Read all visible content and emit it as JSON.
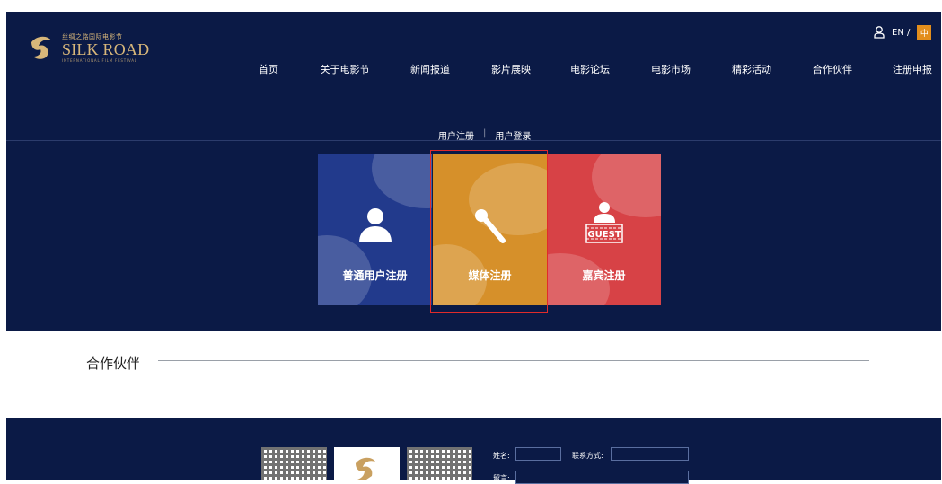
{
  "header": {
    "logo": {
      "cn": "丝绸之路国际电影节",
      "en": "SILK ROAD",
      "sub": "INTERNATIONAL FILM FESTIVAL"
    },
    "nav": [
      "首页",
      "关于电影节",
      "新闻报道",
      "影片展映",
      "电影论坛",
      "电影市场",
      "精彩活动",
      "合作伙伴",
      "注册申报"
    ],
    "lang_en": "EN /",
    "lang_zh": "中",
    "tabs": {
      "register": "用户注册",
      "separator": "|",
      "login": "用户登录"
    }
  },
  "cards": {
    "user": "普通用户注册",
    "media": "媒体注册",
    "guest": "嘉宾注册",
    "guest_icon_text": "GUEST"
  },
  "partners": {
    "title": "合作伙伴"
  },
  "footer": {
    "name_label": "姓名:",
    "contact_label": "联系方式:",
    "message_label": "留言:"
  },
  "colors": {
    "navy": "#0b1a46",
    "card_user": "#223a8c",
    "card_media": "#d6902a",
    "card_guest": "#d74246",
    "highlight": "#e02b2b",
    "accent": "#e38e1c"
  }
}
